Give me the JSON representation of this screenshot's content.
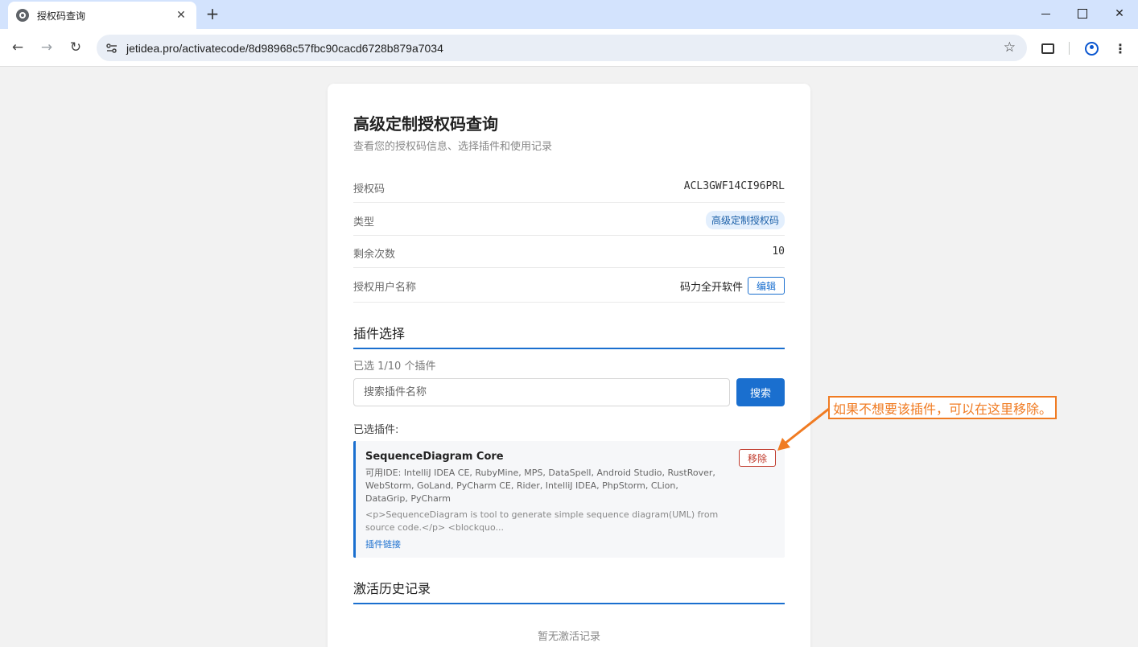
{
  "browser": {
    "tab_title": "授权码查询",
    "url": "jetidea.pro/activatecode/8d98968c57fbc90cacd6728b879a7034"
  },
  "page": {
    "title": "高级定制授权码查询",
    "subtitle": "查看您的授权码信息、选择插件和使用记录"
  },
  "info": {
    "code_label": "授权码",
    "code_value": "ACL3GWF14CI96PRL",
    "type_label": "类型",
    "type_value": "高级定制授权码",
    "remaining_label": "剩余次数",
    "remaining_value": "10",
    "user_label": "授权用户名称",
    "user_value": "码力全开软件",
    "edit_label": "编辑"
  },
  "plugins": {
    "section_title": "插件选择",
    "selected_count": "已选 1/10 个插件",
    "search_placeholder": "搜索插件名称",
    "search_button": "搜索",
    "selected_label": "已选插件:",
    "items": [
      {
        "name": "SequenceDiagram Core",
        "ides": "可用IDE: IntelliJ IDEA CE, RubyMine, MPS, DataSpell, Android Studio, RustRover, WebStorm, GoLand, PyCharm CE, Rider, IntelliJ IDEA, PhpStorm, CLion, DataGrip, PyCharm",
        "description": "<p>SequenceDiagram is tool to generate simple sequence diagram(UML) from source code.</p> <blockquo...",
        "link_label": "插件链接",
        "remove_label": "移除"
      }
    ]
  },
  "history": {
    "section_title": "激活历史记录",
    "empty_text": "暂无激活记录"
  },
  "annotation": {
    "text": "如果不想要该插件，可以在这里移除。",
    "color": "#f07b22"
  },
  "colors": {
    "accent": "#1a6fcf",
    "danger": "#c0392b",
    "chrome_tabbar": "#d3e3fd"
  }
}
